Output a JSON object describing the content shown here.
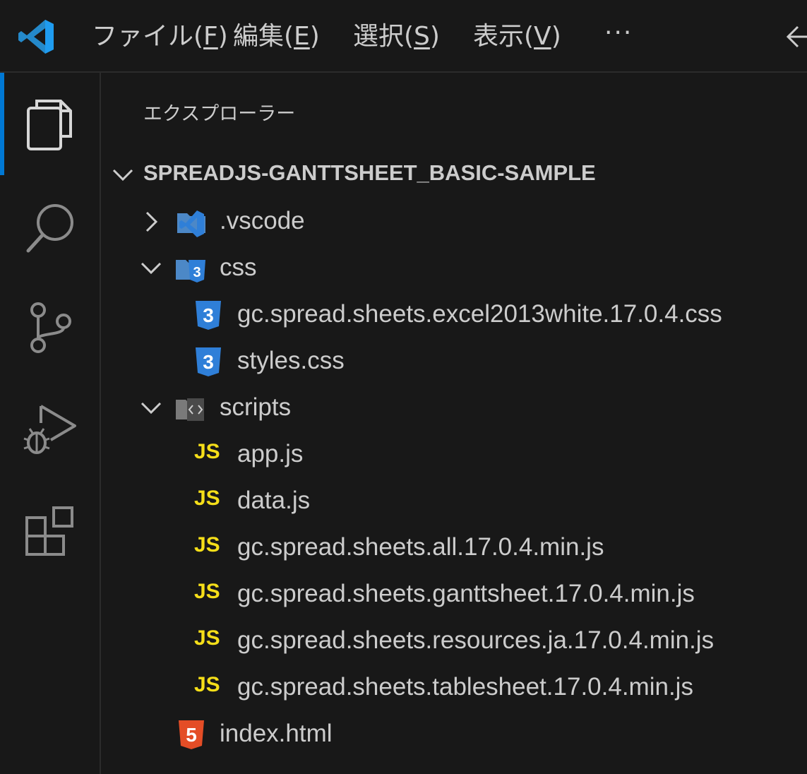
{
  "titlebar": {
    "menu": [
      {
        "prefix": "ファイル(",
        "key": "F",
        "suffix": ")"
      },
      {
        "prefix": "編集(",
        "key": "E",
        "suffix": ")"
      },
      {
        "prefix": "選択(",
        "key": "S",
        "suffix": ")"
      },
      {
        "prefix": "表示(",
        "key": "V",
        "suffix": ")"
      }
    ],
    "more": "···"
  },
  "explorer": {
    "title": "エクスプローラー",
    "root": "SPREADJS-GANTTSHEET_BASIC-SAMPLE",
    "items": [
      {
        "label": ".vscode",
        "icon": "vscode-folder-icon",
        "expanded": false
      },
      {
        "label": "css",
        "icon": "css-folder-icon",
        "expanded": true
      },
      {
        "label": "gc.spread.sheets.excel2013white.17.0.4.css",
        "icon": "css3-icon"
      },
      {
        "label": "styles.css",
        "icon": "css3-icon"
      },
      {
        "label": "scripts",
        "icon": "scripts-folder-icon",
        "expanded": true
      },
      {
        "label": "app.js",
        "badge": "JS"
      },
      {
        "label": "data.js",
        "badge": "JS"
      },
      {
        "label": "gc.spread.sheets.all.17.0.4.min.js",
        "badge": "JS"
      },
      {
        "label": "gc.spread.sheets.ganttsheet.17.0.4.min.js",
        "badge": "JS"
      },
      {
        "label": "gc.spread.sheets.resources.ja.17.0.4.min.js",
        "badge": "JS"
      },
      {
        "label": "gc.spread.sheets.tablesheet.17.0.4.min.js",
        "badge": "JS"
      },
      {
        "label": "index.html",
        "icon": "html5-icon"
      }
    ]
  },
  "colors": {
    "accent": "#0078d4",
    "background": "#181818",
    "js": "#f5de19",
    "css": "#2f7fd8",
    "html": "#e44d26"
  }
}
